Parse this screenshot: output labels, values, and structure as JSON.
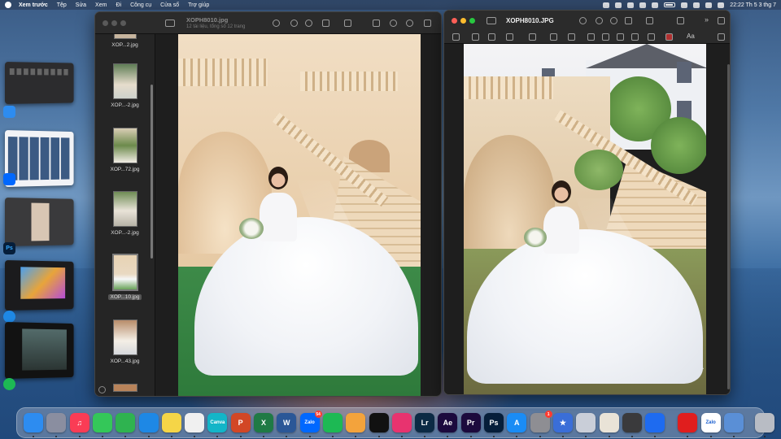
{
  "menubar": {
    "app_name": "Xem trước",
    "items": [
      "Tệp",
      "Sửa",
      "Xem",
      "Đi",
      "Công cụ",
      "Cửa sổ",
      "Trợ giúp"
    ],
    "clock": "22:22 Th 5 3 thg 7"
  },
  "preview_left": {
    "title": "XOPH8010.jpg",
    "subtitle": "12 tài liệu, tổng số 12 trang",
    "thumbnails": [
      {
        "label": "XOP...2.jpg"
      },
      {
        "label": "XOP...-2.jpg"
      },
      {
        "label": "XOP...72.jpg"
      },
      {
        "label": "XOP...-2.jpg"
      },
      {
        "label": "XOP...10.jpg",
        "selected": true
      },
      {
        "label": "XOP...43.jpg"
      }
    ]
  },
  "preview_right": {
    "title": "XOPH8010.JPG",
    "font_menu": "Aa"
  },
  "stage_apps": [
    {
      "icon": "finder-icon",
      "label": ""
    },
    {
      "icon": "zalo-icon",
      "label": ""
    },
    {
      "icon": "photoshop-icon",
      "label": "Ps"
    },
    {
      "icon": "safari-icon",
      "label": ""
    },
    {
      "icon": "spotify-icon",
      "label": ""
    }
  ],
  "dock": {
    "apps": [
      {
        "name": "Finder",
        "icon": "finder-icon",
        "label": "",
        "color": "#2d8cf0"
      },
      {
        "name": "Launchpad",
        "icon": "launchpad-icon",
        "label": "",
        "color": "#8a8ea0"
      },
      {
        "name": "Music",
        "icon": "music-icon",
        "label": "♫",
        "color": "#fa3c55"
      },
      {
        "name": "Messages",
        "icon": "messages-icon",
        "label": "",
        "color": "#34c759"
      },
      {
        "name": "FaceTime",
        "icon": "facetime-icon",
        "label": "",
        "color": "#2fb350"
      },
      {
        "name": "Safari",
        "icon": "safari-icon",
        "label": "",
        "color": "#1e88e5"
      },
      {
        "name": "Notes",
        "icon": "notes-icon",
        "label": "",
        "color": "#f5d547"
      },
      {
        "name": "Photos",
        "icon": "photos-icon",
        "label": "",
        "color": "#f0f0f0"
      },
      {
        "name": "Canva",
        "icon": "canva-icon",
        "label": "Canva",
        "color": "#13b5c8"
      },
      {
        "name": "PowerPoint",
        "icon": "powerpoint-icon",
        "label": "P",
        "color": "#d24726"
      },
      {
        "name": "Excel",
        "icon": "excel-icon",
        "label": "X",
        "color": "#1f7a45"
      },
      {
        "name": "Word",
        "icon": "word-icon",
        "label": "W",
        "color": "#2b5797"
      },
      {
        "name": "Zalo",
        "icon": "zalo-icon",
        "label": "Zalo",
        "color": "#0068ff",
        "badge": "54"
      },
      {
        "name": "Spotify",
        "icon": "spotify-icon",
        "label": "",
        "color": "#1db954"
      },
      {
        "name": "Headset",
        "icon": "headset-icon",
        "label": "",
        "color": "#f3a33c"
      },
      {
        "name": "CapCut",
        "icon": "capcut-icon",
        "label": "",
        "color": "#111111"
      },
      {
        "name": "Creative Cloud",
        "icon": "creative-cloud-icon",
        "label": "",
        "color": "#e8336f"
      },
      {
        "name": "Lightroom",
        "icon": "lightroom-icon",
        "label": "Lr",
        "color": "#0c2a44"
      },
      {
        "name": "After Effects",
        "icon": "after-effects-icon",
        "label": "Ae",
        "color": "#1c0a3d"
      },
      {
        "name": "Premiere Pro",
        "icon": "premiere-icon",
        "label": "Pr",
        "color": "#1c0a3d"
      },
      {
        "name": "Photoshop",
        "icon": "photoshop-icon",
        "label": "Ps",
        "color": "#061e3a"
      },
      {
        "name": "App Store",
        "icon": "appstore-icon",
        "label": "A",
        "color": "#1a8cf5"
      },
      {
        "name": "System Settings",
        "icon": "settings-icon",
        "label": "",
        "color": "#8e8e93",
        "badge": "1"
      },
      {
        "name": "Reeder",
        "icon": "star-icon",
        "label": "★",
        "color": "#3a6ed8"
      },
      {
        "name": "iPhone Mirroring",
        "icon": "phone-icon",
        "label": "",
        "color": "#c9ced8"
      },
      {
        "name": "Pen Tool",
        "icon": "pen-icon",
        "label": "",
        "color": "#e9e3d7"
      },
      {
        "name": "Calculator",
        "icon": "calculator-icon",
        "label": "",
        "color": "#3a3a3c"
      },
      {
        "name": "Roblox",
        "icon": "roblox-icon",
        "label": "",
        "color": "#1e6bf0"
      },
      {
        "name": "Acrobat",
        "icon": "acrobat-icon",
        "label": "",
        "color": "#e01e1e"
      },
      {
        "name": "Zalo Mini",
        "icon": "zalo-icon",
        "label": "Zalo",
        "color": "#ffffff"
      },
      {
        "name": "Preview",
        "icon": "preview-icon",
        "label": "",
        "color": "#5a8fd6"
      },
      {
        "name": "Trash",
        "icon": "trash-icon",
        "label": "",
        "color": "#b8bcc4"
      }
    ]
  }
}
